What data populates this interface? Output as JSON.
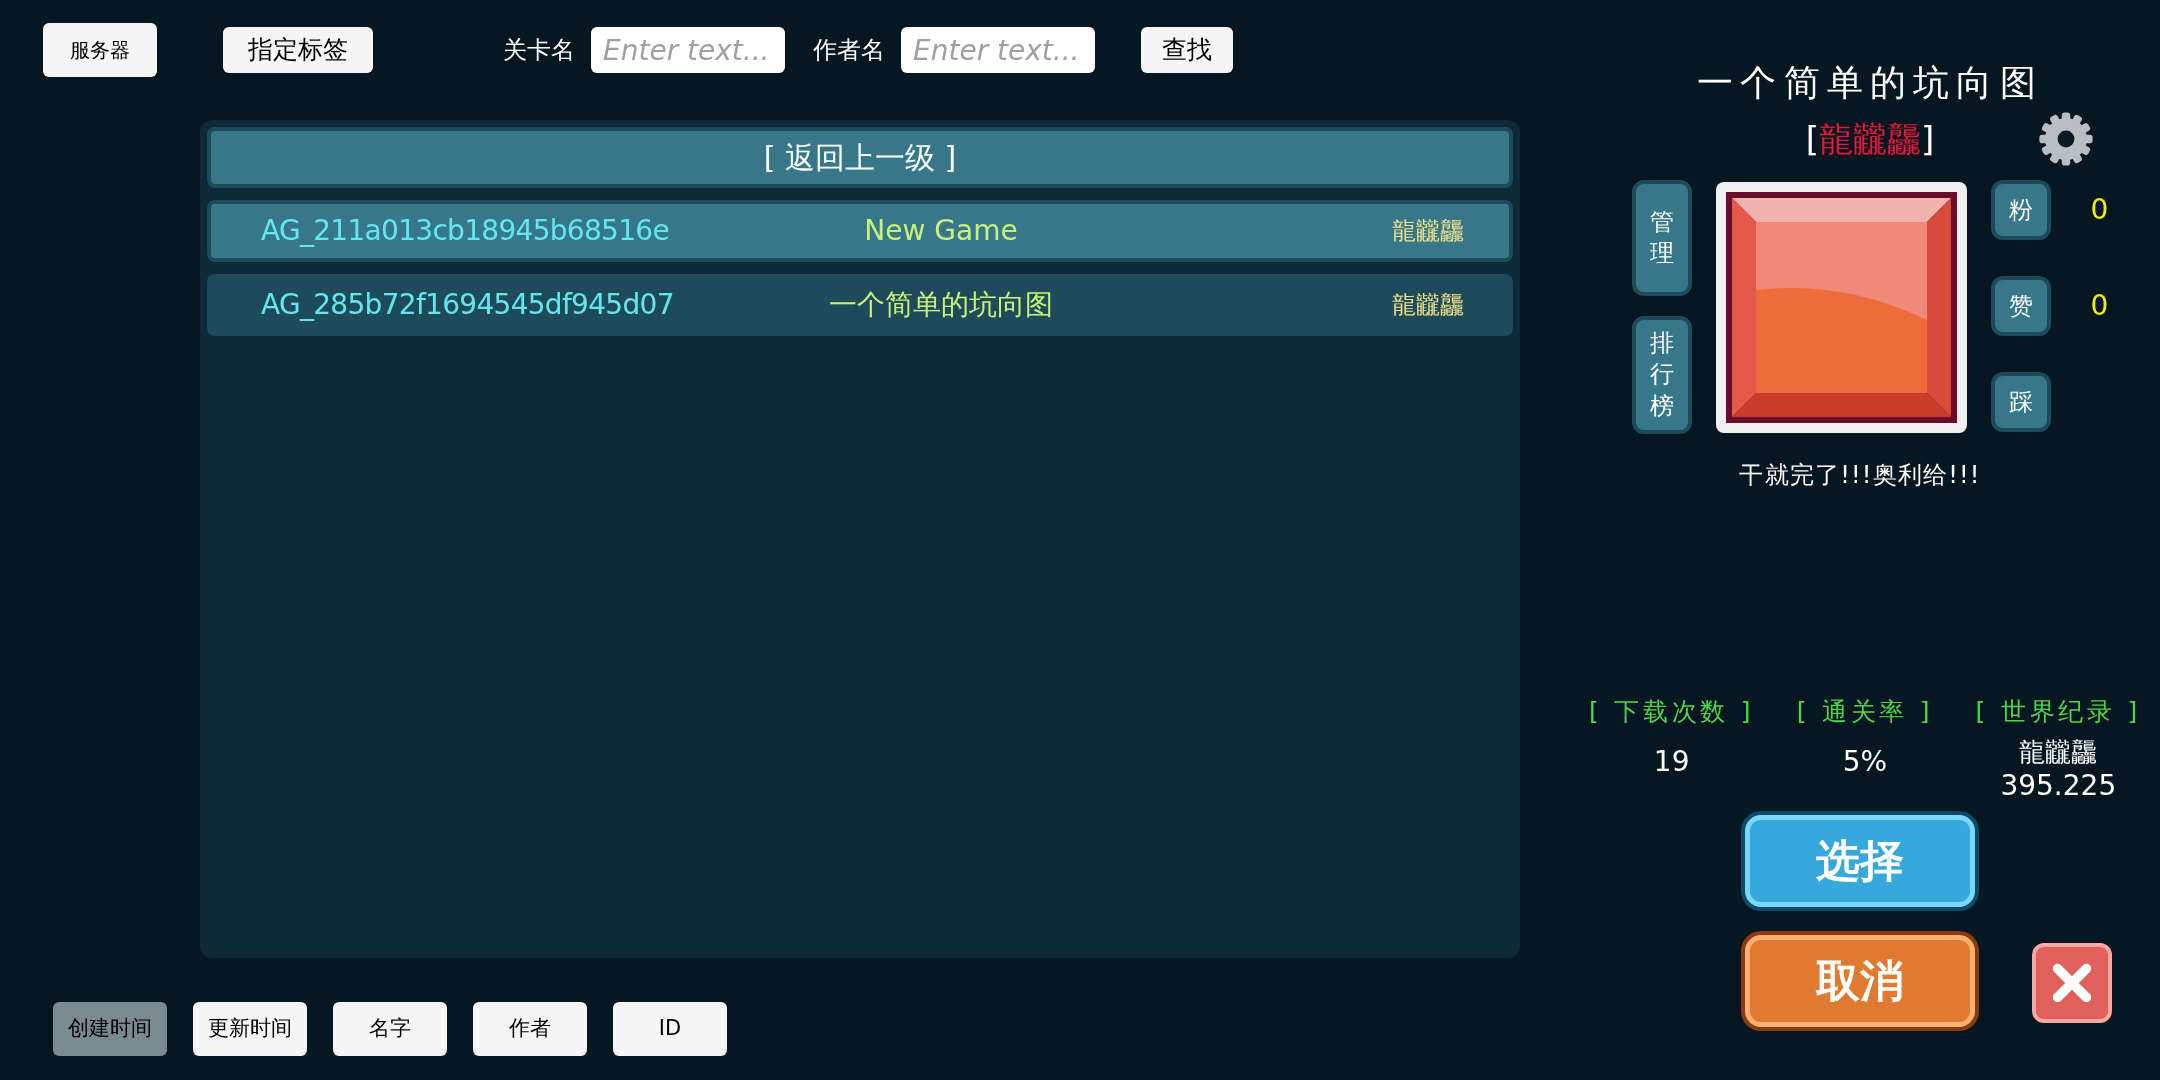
{
  "toolbar": {
    "server_button": "服务器",
    "tag_button": "指定标签",
    "level_name": {
      "label": "关卡名",
      "placeholder": "Enter text..."
    },
    "author_name": {
      "label": "作者名",
      "placeholder": "Enter text..."
    },
    "search_button": "查找"
  },
  "list": {
    "back_row": "[ 返回上一级 ]",
    "rows": [
      {
        "id": "AG_211a013cb18945b68516e",
        "name": "New Game",
        "author": "龍龖龘",
        "selected": true
      },
      {
        "id": "AG_285b72f1694545df945d07",
        "name": "一个简单的坑向图",
        "author": "龍龖龘",
        "selected": false
      }
    ]
  },
  "sort_buttons": [
    {
      "label": "创建时间",
      "selected": true
    },
    {
      "label": "更新时间",
      "selected": false
    },
    {
      "label": "名字",
      "selected": false
    },
    {
      "label": "作者",
      "selected": false
    },
    {
      "label": "ID",
      "selected": false
    }
  ],
  "detail": {
    "title": "一个简单的坑向图",
    "author_open": "[",
    "author": "龍龖龘",
    "author_close": "]",
    "left_buttons": [
      "管理",
      "排行榜"
    ],
    "right_buttons": [
      {
        "label": "粉",
        "count": "0"
      },
      {
        "label": "赞",
        "count": "0"
      },
      {
        "label": "踩"
      }
    ],
    "caption": "干就完了!!!奥利给!!!",
    "stats": [
      {
        "label": "[ 下载次数 ]",
        "value": "19"
      },
      {
        "label": "[ 通关率 ]",
        "value": "5%"
      },
      {
        "label": "[ 世界纪录 ]",
        "holder": "龍龖龘",
        "value": "395.225"
      }
    ],
    "select_button": "选择",
    "cancel_button": "取消"
  }
}
